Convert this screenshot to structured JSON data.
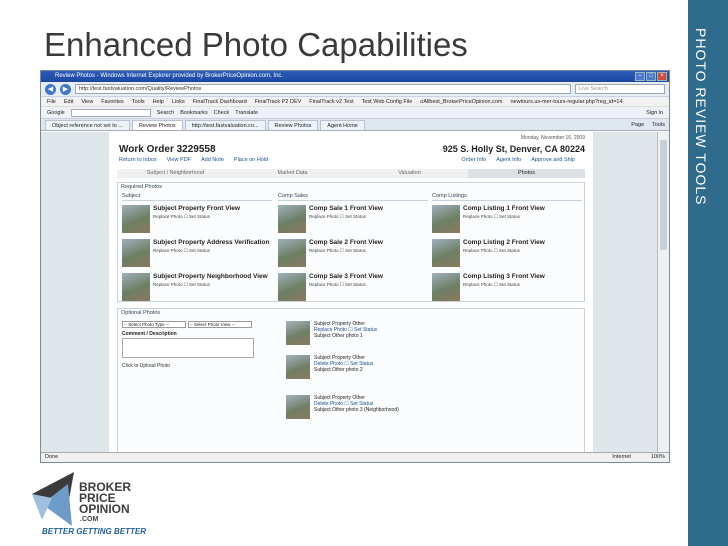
{
  "slide": {
    "title": "Enhanced Photo Capabilities",
    "side_label": "PHOTO REVIEW TOOLS"
  },
  "browser": {
    "title": "Review Photos - Windows Internet Explorer provided by BrokerPriceOpinion.com, Inc.",
    "url": "http://test.fastvaluation.com/Quality/ReviewPhotos",
    "search_placeholder": "Live Search",
    "menu": [
      "File",
      "Edit",
      "View",
      "Favorites",
      "Tools",
      "Help",
      "Links",
      "FinalTrack Dashboard",
      "FinalTrack P2 DEV",
      "FinalTrack v2 Test",
      "Test Web Config File",
      "oAllbest_BrokerPriceOpinion.com",
      "newtours.us-mer-tours-regular.php?reg_id=14"
    ],
    "google_bar": [
      "Google",
      "Search",
      "Bookmarks",
      "Check",
      "Translate",
      "Sign in"
    ],
    "tabs": [
      "Object reference not set to ...",
      "Review Photos",
      "http://test.fastvaluation.co...",
      "Review Photos",
      "Agent Home"
    ],
    "tab_tools": [
      "Page",
      "Tools"
    ],
    "status_left": "Done",
    "status_zone": "Internet",
    "zoom": "100%"
  },
  "page": {
    "date": "Monday, November 16, 2009",
    "work_order": "Work Order 3229558",
    "address": "925 S. Holly St, Denver, CA 80224",
    "actions": {
      "inbox": "Return to Inbox",
      "pdf": "View PDF",
      "note": "Add Note",
      "hold": "Place on Hold",
      "order": "Order Info",
      "agent": "Agent Info",
      "approve": "Approve and Ship"
    },
    "tabs": [
      "Subject / Neighborhood",
      "Market Data",
      "Valuation",
      "Photos"
    ],
    "required_title": "Required Photos",
    "subject_head": "Subject",
    "comp_sales_head": "Comp Sales",
    "comp_list_head": "Comp Listings",
    "row_sub": "Replace Photo  ☐ Set Status",
    "subject": [
      "Subject Property Front View",
      "Subject Property Address Verification",
      "Subject Property Neighborhood View"
    ],
    "comp_sales": [
      "Comp Sale 1 Front View",
      "Comp Sale 2 Front View",
      "Comp Sale 3 Front View"
    ],
    "comp_list": [
      "Comp Listing 1 Front View",
      "Comp Listing 2 Front View",
      "Comp Listing 3 Front View"
    ],
    "optional_title": "Optional Photos",
    "type_select": "-- Select Photo Type --",
    "view_select": "-- Select Photo View --",
    "comment": "Comment / Description",
    "upload": "Click to Upload Photo",
    "optional": [
      {
        "title": "Subject Property Other",
        "link": "Replace Photo  ☐ Set Status",
        "desc": "Subject Other photo 1"
      },
      {
        "title": "Subject Property Other",
        "link": "Delete Photo  ☐ Set Status",
        "desc": "Subject Other photo 2"
      },
      {
        "title": "Subject Property Other",
        "link": "Delete Photo  ☐ Set Status",
        "desc": "Subject Other photo 3 (Neighborhood)"
      }
    ]
  },
  "logo": {
    "line1": "BROKER",
    "line2": "PRICE",
    "line3": "OPINION",
    "dotcom": ".COM",
    "tagline": "BETTER GETTING BETTER"
  }
}
